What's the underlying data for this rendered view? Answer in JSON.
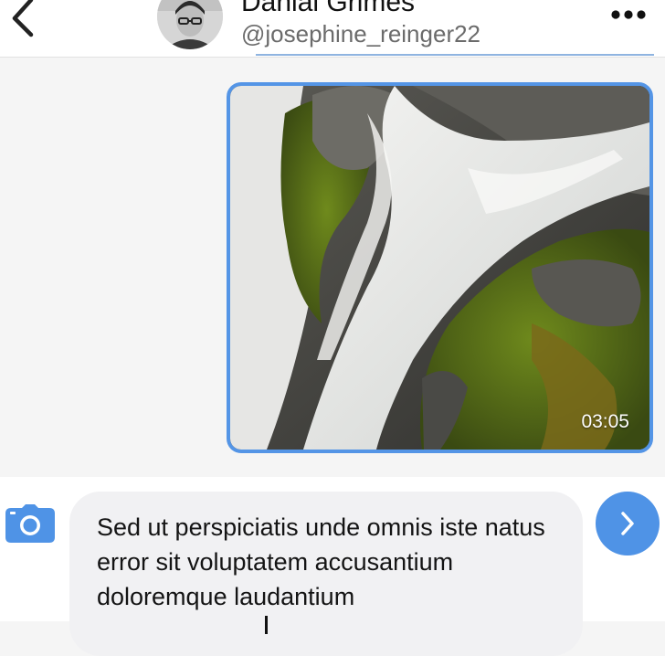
{
  "header": {
    "contact_name": "Danial Grimes",
    "contact_handle": "@josephine_reinger22",
    "back_icon": "chevron-left-icon",
    "more_icon": "ellipsis-horizontal-icon"
  },
  "conversation": {
    "media_message": {
      "kind": "video",
      "duration": "03:05"
    }
  },
  "composer": {
    "camera_icon": "camera-icon",
    "message_text": "Sed ut perspiciatis unde omnis iste natus error sit voluptatem accusantium doloremque laudantium",
    "send_icon": "chevron-right-icon"
  },
  "colors": {
    "accent": "#4f93e6",
    "bubble_border": "#5495e6",
    "header_bg": "#ffffff",
    "conversation_bg": "#f5f5f5",
    "input_bg": "#f1f1f3"
  }
}
